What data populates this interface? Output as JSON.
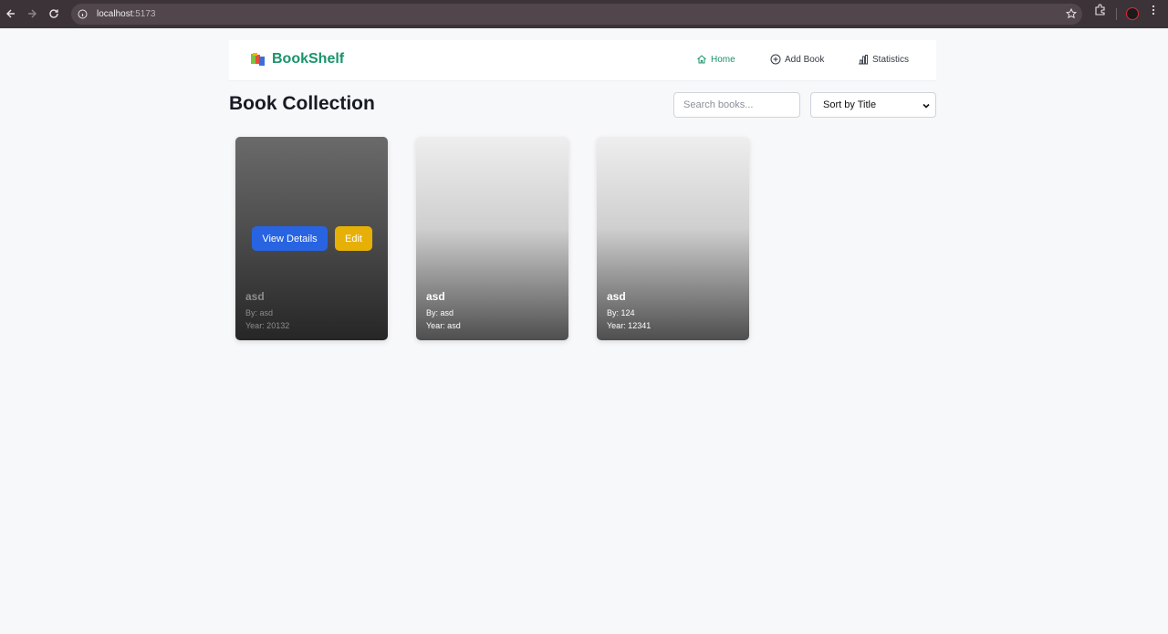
{
  "browser": {
    "url_host": "localhost",
    "url_port": ":5173"
  },
  "app": {
    "brand": "BookShelf",
    "nav": [
      {
        "label": "Home",
        "icon": "home-icon",
        "active": true
      },
      {
        "label": "Add Book",
        "icon": "plus-circle-icon",
        "active": false
      },
      {
        "label": "Statistics",
        "icon": "bar-chart-icon",
        "active": false
      }
    ]
  },
  "page": {
    "title": "Book Collection",
    "search_placeholder": "Search books...",
    "sort_value": "Sort by Title"
  },
  "books": [
    {
      "title": "asd",
      "author": "By: asd",
      "year": "Year: 20132",
      "hovered": true
    },
    {
      "title": "asd",
      "author": "By: asd",
      "year": "Year: asd",
      "hovered": false
    },
    {
      "title": "asd",
      "author": "By: 124",
      "year": "Year: 12341",
      "hovered": false
    }
  ],
  "card_actions": {
    "view": "View Details",
    "edit": "Edit"
  },
  "colors": {
    "brand": "#1a9469",
    "view_button": "#2864e2",
    "edit_button": "#e6b006"
  }
}
